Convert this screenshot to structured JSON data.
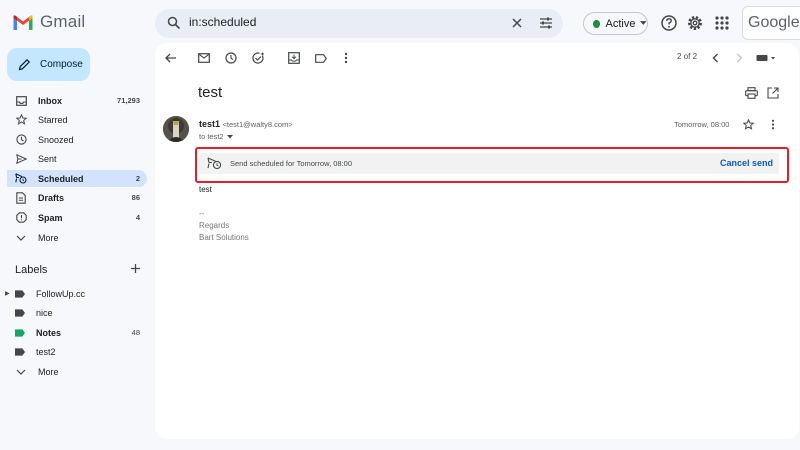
{
  "app": {
    "name": "Gmail",
    "brand": "Google"
  },
  "search": {
    "query": "in:scheduled"
  },
  "status": {
    "label": "Active",
    "color": "#1e8e3e"
  },
  "compose": {
    "label": "Compose"
  },
  "sidebar": {
    "items": [
      {
        "label": "Inbox",
        "count": "71,293",
        "icon": "inbox-icon",
        "bold": true
      },
      {
        "label": "Starred",
        "count": "",
        "icon": "star-icon"
      },
      {
        "label": "Snoozed",
        "count": "",
        "icon": "clock-icon"
      },
      {
        "label": "Sent",
        "count": "",
        "icon": "send-icon"
      },
      {
        "label": "Scheduled",
        "count": "2",
        "icon": "scheduled-send-icon",
        "bold": true,
        "selected": true
      },
      {
        "label": "Drafts",
        "count": "86",
        "icon": "draft-icon",
        "bold": true
      },
      {
        "label": "Spam",
        "count": "4",
        "icon": "spam-icon",
        "bold": true
      },
      {
        "label": "More",
        "count": "",
        "icon": "chevron-down-icon"
      }
    ]
  },
  "labels": {
    "title": "Labels",
    "items": [
      {
        "label": "FollowUp.cc",
        "count": "",
        "color": "#444746",
        "expandable": true
      },
      {
        "label": "nice",
        "count": "",
        "color": "#444746"
      },
      {
        "label": "Notes",
        "count": "48",
        "color": "#16a765",
        "bold": true
      },
      {
        "label": "test2",
        "count": "",
        "color": "#444746"
      },
      {
        "label": "More",
        "count": "",
        "icon": "chevron-down-icon"
      }
    ]
  },
  "toolbar": {
    "pager": "2 of 2"
  },
  "message": {
    "subject": "test",
    "sender_name": "test1",
    "sender_email": "<test1@walty8.com>",
    "recipient": "to test2",
    "time": "Tomorrow, 08:00",
    "scheduled_text": "Send scheduled for Tomorrow, 08:00",
    "cancel_label": "Cancel send",
    "body": "test",
    "signature_sep": "--",
    "signature_line1": "Regards",
    "signature_line2": "Bart Solutions"
  },
  "colors": {
    "accent": "#0b57d0",
    "selected_bg": "#d3e3fd",
    "compose_bg": "#c2e7ff",
    "highlight_box": "#e3202a"
  }
}
